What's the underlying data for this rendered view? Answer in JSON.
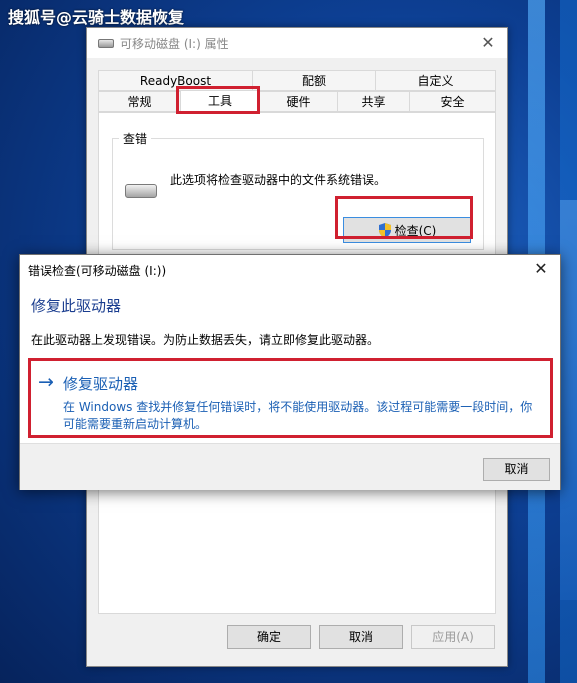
{
  "watermark": "搜狐号@云骑士数据恢复",
  "properties_window": {
    "title": "可移动磁盘 (I:) 属性",
    "tabs_row1": [
      "ReadyBoost",
      "配额",
      "自定义"
    ],
    "tabs_row2": [
      "常规",
      "工具",
      "硬件",
      "共享",
      "安全"
    ],
    "active_tab": "工具",
    "group_title": "查错",
    "group_desc": "此选项将检查驱动器中的文件系统错误。",
    "check_button": "检查(C)",
    "buttons": {
      "ok": "确定",
      "cancel": "取消",
      "apply": "应用(A)"
    }
  },
  "error_dialog": {
    "title": "错误检查(可移动磁盘 (I:))",
    "heading": "修复此驱动器",
    "message": "在此驱动器上发现错误。为防止数据丢失，请立即修复此驱动器。",
    "option_title": "修复驱动器",
    "option_desc": "在 Windows 查找并修复任何错误时，将不能使用驱动器。该过程可能需要一段时间，你可能需要重新启动计算机。",
    "cancel": "取消"
  },
  "colors": {
    "highlight": "#d02030",
    "link_blue": "#1a5fb4",
    "heading_blue": "#1a3d8f"
  }
}
